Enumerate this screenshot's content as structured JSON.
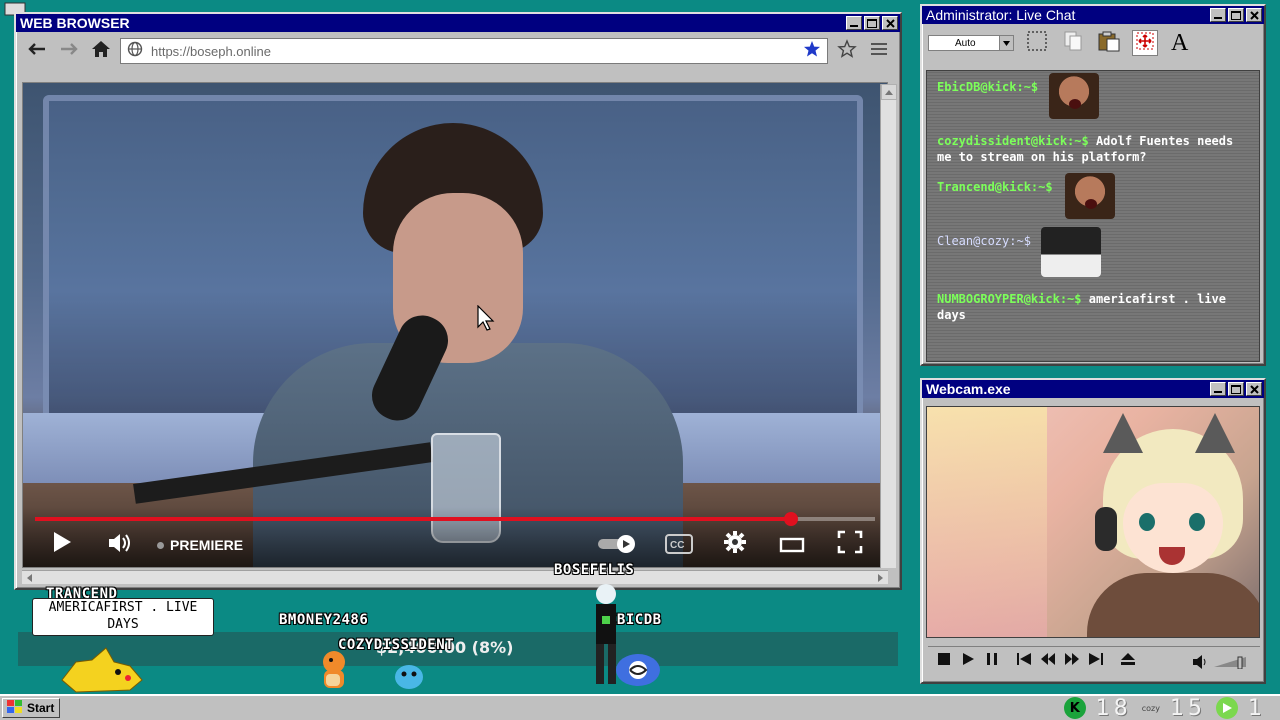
{
  "browser": {
    "title": "WEB BROWSER",
    "url": "https://boseph.online",
    "video": {
      "progress": 0.9,
      "premiere_label": "PREMIERE"
    }
  },
  "chat": {
    "title": "Administrator: Live Chat",
    "select_value": "Auto",
    "messages": [
      {
        "user": "EbicDB@kick:~$",
        "text": "",
        "image": "face"
      },
      {
        "user": "cozydissident@kick:~$",
        "text": "Adolf Fuentes needs me to stream on his platform?",
        "image": ""
      },
      {
        "user": "Trancend@kick:~$",
        "text": "",
        "image": "face"
      },
      {
        "user": "Clean@cozy:~$",
        "text": "",
        "image": "anime"
      },
      {
        "user": "NUMBOGROYPER@kick:~$",
        "text": "americafirst . live days",
        "image": ""
      }
    ]
  },
  "webcam": {
    "title": "Webcam.exe"
  },
  "overlay": {
    "ticker": "$2,400.00 (8%)",
    "bubble": "AMERICAFIRST . LIVE DAYS",
    "names": {
      "trancend": "TRANCEND",
      "bmoney": "BMONEY2486",
      "cozy": "COZYDISSIDENT",
      "bosefelis": "BOSEFELIS",
      "ebicdb": "EBICDB"
    }
  },
  "taskbar": {
    "start_label": "Start",
    "tray_num1": "18",
    "tray_small": "cozy",
    "tray_num2": "15",
    "tray_num3": "1"
  }
}
